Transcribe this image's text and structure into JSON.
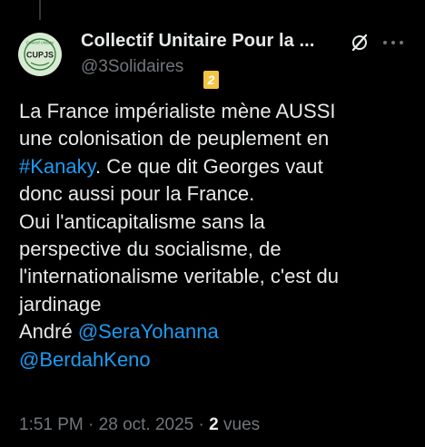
{
  "tweet": {
    "author": {
      "display_name": "Collectif Unitaire Pour la ...",
      "handle": "@3Solidaires",
      "avatar_text": "CUPJS",
      "avatar_ring_text": "Collectif Unitaire"
    },
    "badge_number": "2",
    "body": {
      "line1": "La France impérialiste mène AUSSI",
      "line2": "une colonisation de peuplement en",
      "hashtag": "#Kanaky",
      "line3_rest": ". Ce que dit Georges vaut",
      "line4": "donc aussi pour la France.",
      "line5": "Oui l'anticapitalisme sans la",
      "line6": "perspective du socialisme, de",
      "line7": "l'internationalisme veritable, c'est du",
      "line8": "jardinage",
      "signature": "André ",
      "mention1": "@SeraYohanna",
      "mention2": "@BerdahKeno"
    },
    "meta": {
      "time": "1:51 PM",
      "separator": " · ",
      "date": "28 oct. 2025",
      "views_count": "2",
      "views_label": " vues"
    },
    "icons": {
      "grok": "slash-circle-icon",
      "more": "more-horizontal-icon"
    }
  },
  "colors": {
    "background": "#000000",
    "text_primary": "#e7e9ea",
    "text_secondary": "#71767b",
    "link": "#1d9bf0",
    "badge": "#f6c445",
    "avatar_bg": "#d8ead2",
    "avatar_ring": "#2f7d3a"
  }
}
